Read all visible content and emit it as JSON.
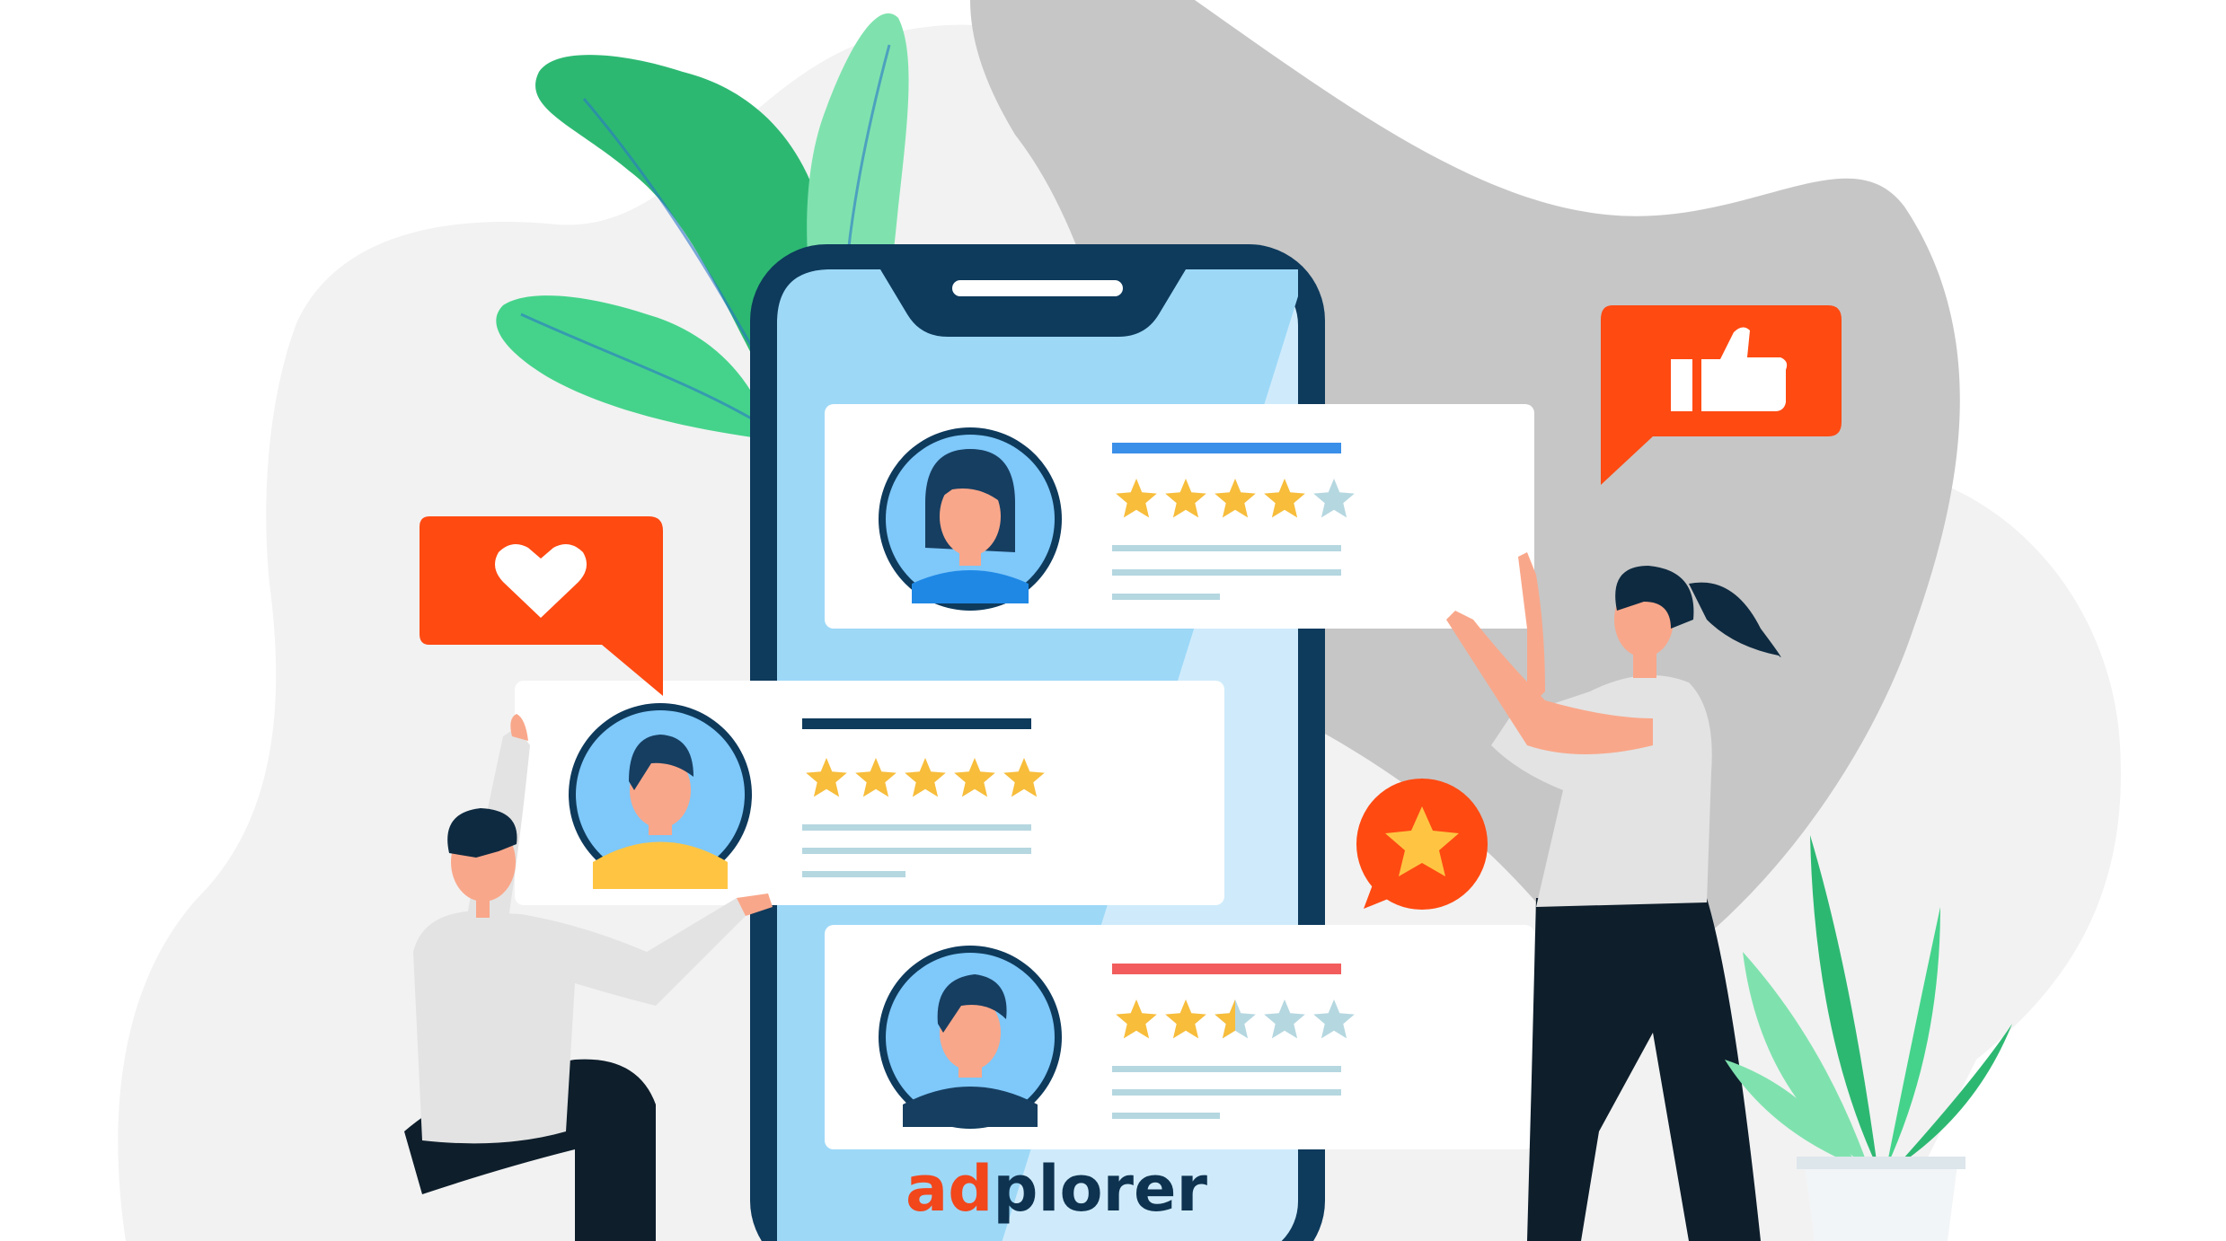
{
  "brand": {
    "part1": "ad",
    "part2": "plorer",
    "color_part1": "#F2461B",
    "color_part2": "#0E3350"
  },
  "colors": {
    "blob_light": "#F2F2F2",
    "blob_dark": "#C6C6C6",
    "phone_frame": "#0E3A5C",
    "screen_light": "#CFEBFB",
    "screen_dark": "#9DD8F7",
    "card": "#FFFFFF",
    "star_filled": "#F7BD3B",
    "star_empty": "#B5D7E0",
    "accent_orange": "#FF4A12",
    "leaf_dark": "#2DB872",
    "leaf_light": "#7FE2AE"
  },
  "icons": {
    "heart_bubble": "heart-icon",
    "thumbs_up_bubble": "thumbs-up-icon",
    "star_bubble": "star-icon"
  },
  "reviews": [
    {
      "avatar": "female-avatar",
      "rating": 4,
      "max_rating": 5,
      "bar_color": "#3A8FE8"
    },
    {
      "avatar": "male-avatar-yellow",
      "rating": 5,
      "max_rating": 5,
      "bar_color": "#0E3A5C"
    },
    {
      "avatar": "male-avatar-navy",
      "rating": 2.5,
      "max_rating": 5,
      "bar_color": "#F25C5C"
    }
  ]
}
